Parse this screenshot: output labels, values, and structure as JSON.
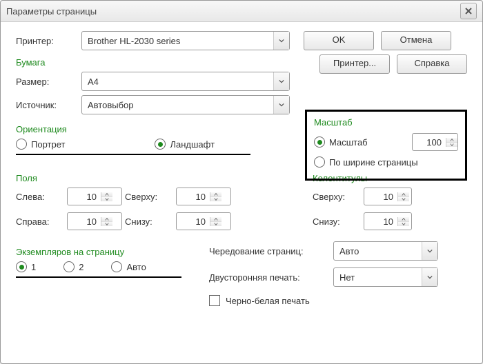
{
  "title": "Параметры страницы",
  "buttons": {
    "ok": "OK",
    "cancel": "Отмена",
    "printer": "Принтер...",
    "help": "Справка"
  },
  "groups": {
    "paper": "Бумага",
    "orientation": "Ориентация",
    "scale": "Масштаб",
    "margins": "Поля",
    "headfoot": "Колонтитулы",
    "copies": "Экземпляров на страницу"
  },
  "labels": {
    "printer_rest": "интер:",
    "size_rest": "азмер:",
    "source": "Источник:",
    "portrait_rest": "ртрет",
    "landscape": "Ландшафт",
    "scale_rest": "асштаб",
    "fitwidth_rest": "ирине страницы",
    "left_rest": "ева:",
    "right_rest": "рава:",
    "top_rest": "ерху:",
    "bottom_rest": "изу:",
    "hf_top": "Сверху:",
    "hf_bottom": "Снизу:",
    "c1": "1",
    "c2": "2",
    "auto_rest": "вто",
    "alternation": "Чередование страниц:",
    "duplex": "Двусторонняя печать:",
    "bw_rest": "ерно-белая печать"
  },
  "values": {
    "printer": "Brother HL-2030 series",
    "size": "A4",
    "source": "Автовыбор",
    "scale": "100",
    "left": "10",
    "right": "10",
    "top": "10",
    "bottom": "10",
    "hf_top": "10",
    "hf_bottom": "10",
    "alternation": "Авто",
    "duplex": "Нет"
  },
  "orientation_selected": "landscape",
  "copies_selected": "1",
  "scale_mode": "scale",
  "bw_checked": false
}
